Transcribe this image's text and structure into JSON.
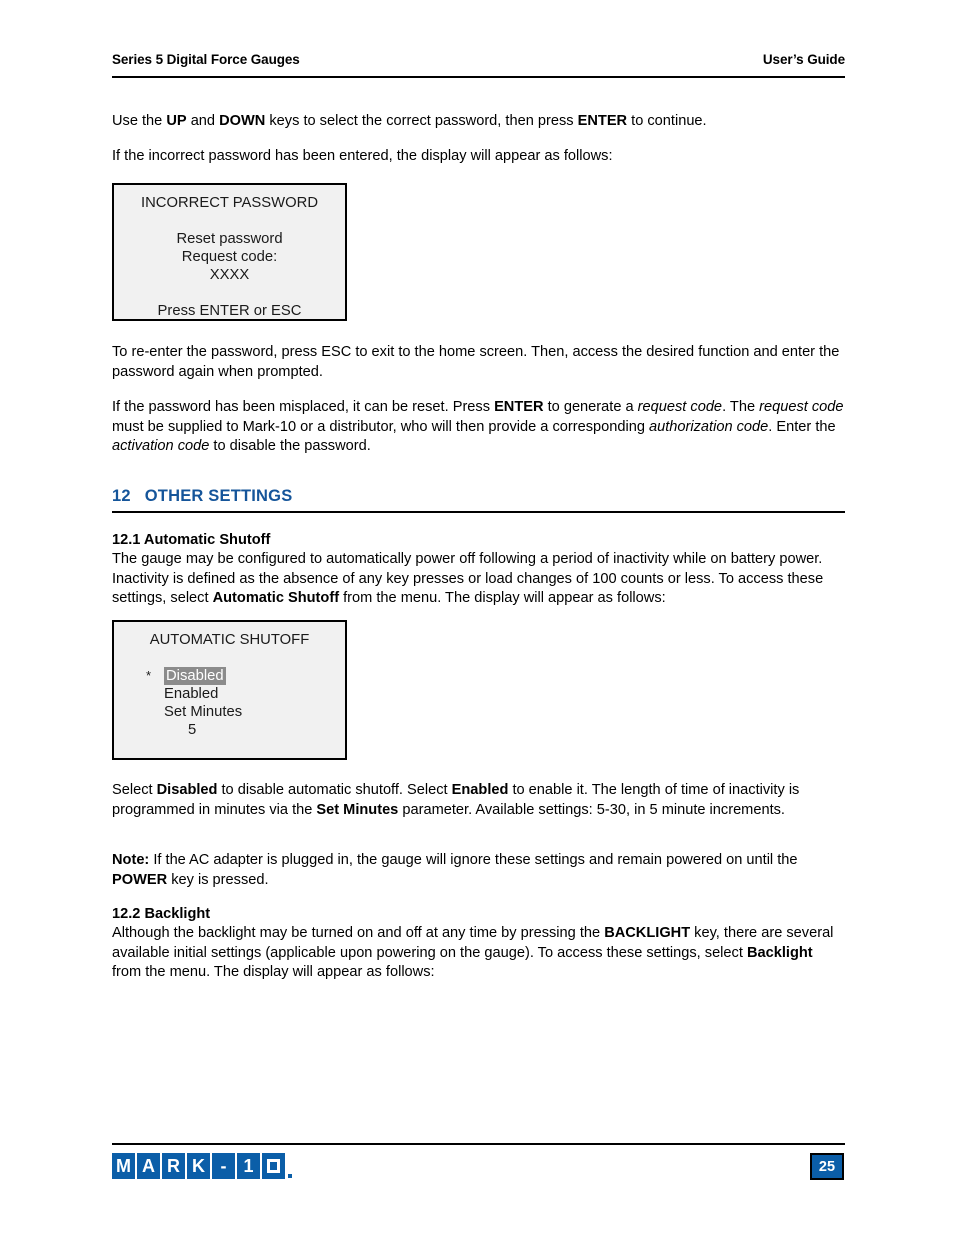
{
  "header": {
    "left": "Series 5 Digital Force Gauges",
    "right": "User’s Guide"
  },
  "body": {
    "p1_pre": "Use the ",
    "p1_b1": "UP",
    "p1_mid1": " and ",
    "p1_b2": "DOWN",
    "p1_mid2": " keys to select the correct password, then press ",
    "p1_b3": "ENTER",
    "p1_end": " to continue.",
    "p2": "If the incorrect password has been entered, the display will appear as follows:",
    "p3": "To re-enter the password, press ESC to exit to the home screen. Then, access the desired function and enter the password again when prompted.",
    "p4_pre": "If the password has been misplaced, it can be reset. Press ",
    "p4_b1": "ENTER",
    "p4_mid1": " to generate a ",
    "p4_i1": "request code",
    "p4_mid2": ". The ",
    "p4_i2": "request code",
    "p4_mid3": " must be supplied to Mark-10 or a distributor, who will then provide a corresponding ",
    "p4_i3": "authorization code",
    "p4_mid4": ". Enter the ",
    "p4_i4": "activation code",
    "p4_end": " to disable the password."
  },
  "section": {
    "number": "12",
    "title": "OTHER SETTINGS"
  },
  "subsection_121": {
    "heading": "12.1 Automatic Shutoff",
    "p_pre": "The gauge may be configured to automatically power off following a period of inactivity while on battery power. Inactivity is defined as the absence of any key presses or load changes of 100 counts or less. To access these settings, select ",
    "p_b1": "Automatic Shutoff",
    "p_end": " from the menu. The display will appear as follows:",
    "after_pre": "Select ",
    "after_b1": "Disabled",
    "after_mid1": " to disable automatic shutoff. Select ",
    "after_b2": "Enabled",
    "after_mid2": " to enable it. The length of time of inactivity is programmed in minutes via the ",
    "after_b3": "Set Minutes",
    "after_end": " parameter. Available settings: 5-30, in 5 minute increments.",
    "note_label": "Note:",
    "note_mid1": " If the AC adapter is plugged in, the gauge will ignore these settings and remain powered on until the ",
    "note_b1": "POWER",
    "note_end": " key is pressed."
  },
  "subsection_122": {
    "heading": "12.2 Backlight",
    "p_pre": "Although the backlight may be turned on and off at any time by pressing the ",
    "p_b1": "BACKLIGHT",
    "p_mid1": " key, there are several available initial settings (applicable upon powering on the gauge). To access these settings, select ",
    "p_b2": "Backlight",
    "p_end": " from the menu. The display will appear as follows:"
  },
  "lcd_incorrect_password": {
    "title": "INCORRECT PASSWORD",
    "line1": "Reset password",
    "line2": "Request code:",
    "line3": "XXXX",
    "line4": "Press ENTER or ESC"
  },
  "lcd_automatic_shutoff": {
    "title": "AUTOMATIC SHUTOFF",
    "star": "*",
    "option1": "Disabled",
    "option2": "Enabled",
    "option3": "Set Minutes",
    "value": "5"
  },
  "footer": {
    "logo_letters": [
      "M",
      "A",
      "R",
      "K",
      "-",
      "1",
      "0"
    ],
    "page_number": "25"
  },
  "colors": {
    "brand_blue": "#0b5ea8",
    "heading_blue": "#15559a",
    "lcd_background": "#f1f1f1",
    "selection_gray": "#8b8b8b"
  }
}
